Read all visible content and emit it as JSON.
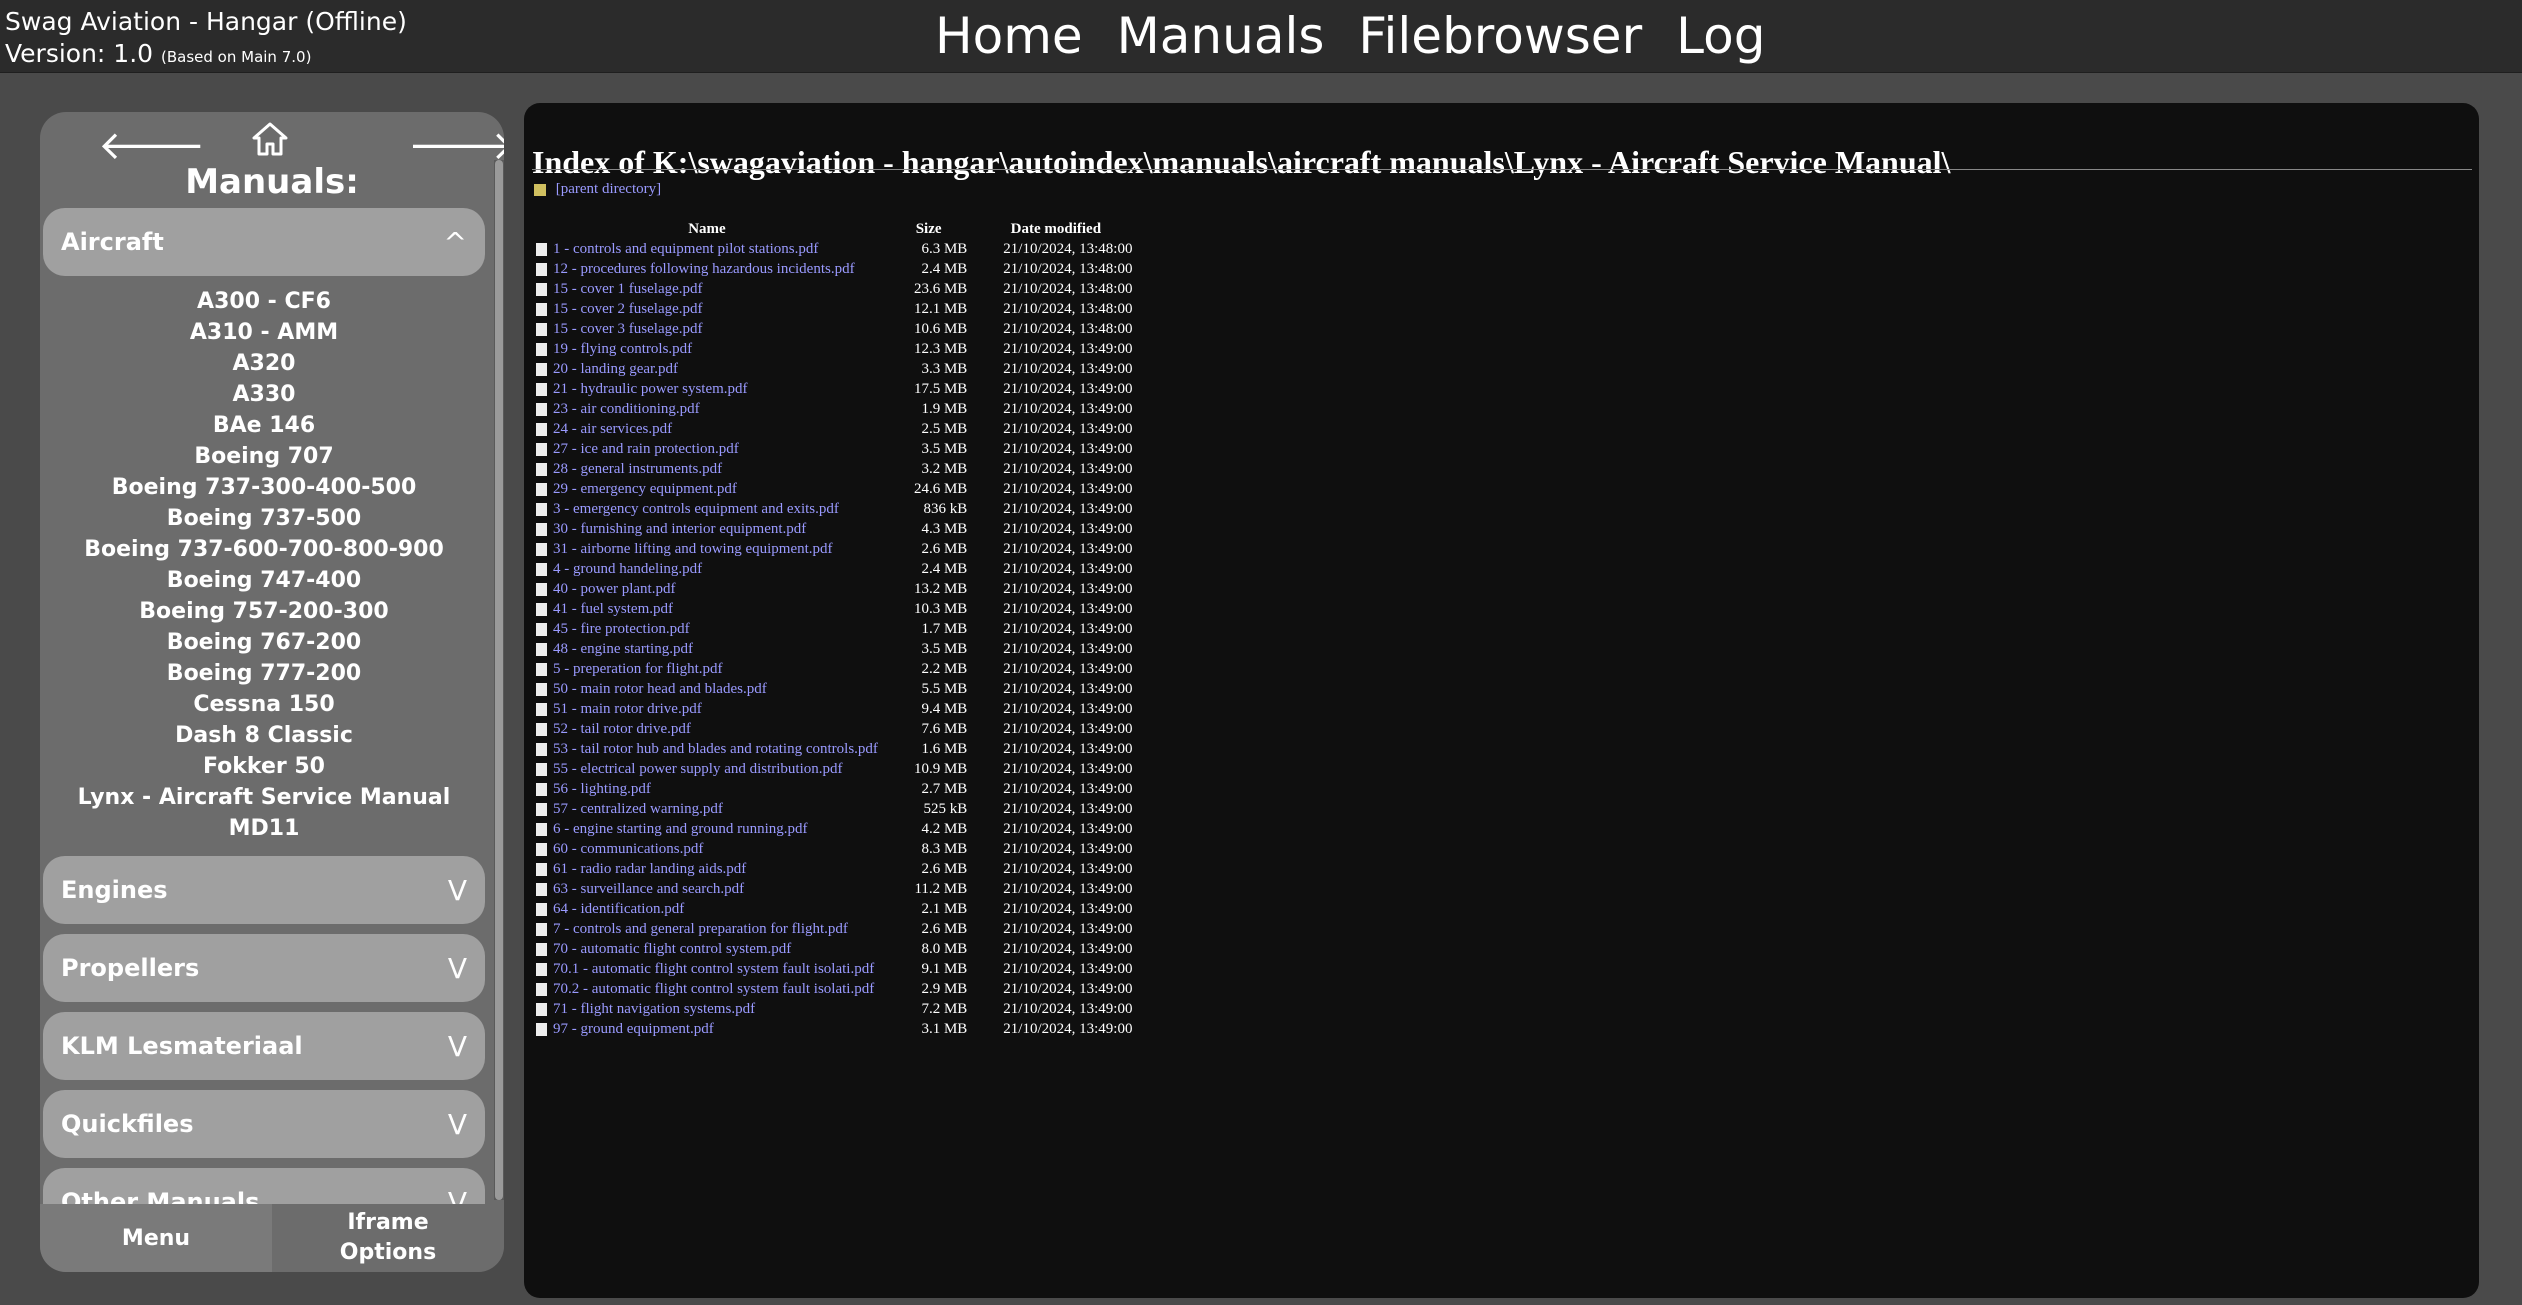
{
  "header": {
    "title": "Swag Aviation - Hangar (Offline)",
    "version": "Version: 1.0",
    "version_note": "(Based on Main 7.0)",
    "nav": [
      "Home",
      "Manuals",
      "Filebrowser",
      "Log"
    ]
  },
  "sidebar": {
    "back": "🡐",
    "forward": "🡒",
    "title": "Manuals:",
    "sections": [
      {
        "label": "Aircraft",
        "chevron": "^",
        "expanded": true,
        "items": [
          "A300 - CF6",
          "A310 - AMM",
          "A320",
          "A330",
          "BAe 146",
          "Boeing 707",
          "Boeing 737-300-400-500",
          "Boeing 737-500",
          "Boeing 737-600-700-800-900",
          "Boeing 747-400",
          "Boeing 757-200-300",
          "Boeing 767-200",
          "Boeing 777-200",
          "Cessna 150",
          "Dash 8 Classic",
          "Fokker 50",
          "Lynx - Aircraft Service Manual",
          "MD11"
        ]
      },
      {
        "label": "Engines",
        "chevron": "V"
      },
      {
        "label": "Propellers",
        "chevron": "V"
      },
      {
        "label": "KLM Lesmateriaal",
        "chevron": "V"
      },
      {
        "label": "Quickfiles",
        "chevron": "V"
      },
      {
        "label": "Other Manuals",
        "chevron": "V"
      }
    ],
    "bottom_tabs": {
      "menu": "Menu",
      "iframe_line1": "Iframe",
      "iframe_line2": "Options"
    }
  },
  "index": {
    "title": "Index of K:\\swagaviation - hangar\\autoindex\\manuals\\aircraft manuals\\Lynx - Aircraft Service Manual\\",
    "parent": "[parent directory]",
    "columns": [
      "Name",
      "Size",
      "Date modified"
    ],
    "files": [
      [
        "1 - controls and equipment pilot stations.pdf",
        "6.3 MB",
        "21/10/2024, 13:48:00"
      ],
      [
        "12 - procedures following hazardous incidents.pdf",
        "2.4 MB",
        "21/10/2024, 13:48:00"
      ],
      [
        "15 - cover 1 fuselage.pdf",
        "23.6 MB",
        "21/10/2024, 13:48:00"
      ],
      [
        "15 - cover 2 fuselage.pdf",
        "12.1 MB",
        "21/10/2024, 13:48:00"
      ],
      [
        "15 - cover 3 fuselage.pdf",
        "10.6 MB",
        "21/10/2024, 13:48:00"
      ],
      [
        "19 - flying controls.pdf",
        "12.3 MB",
        "21/10/2024, 13:49:00"
      ],
      [
        "20 - landing gear.pdf",
        "3.3 MB",
        "21/10/2024, 13:49:00"
      ],
      [
        "21 - hydraulic power system.pdf",
        "17.5 MB",
        "21/10/2024, 13:49:00"
      ],
      [
        "23 - air conditioning.pdf",
        "1.9 MB",
        "21/10/2024, 13:49:00"
      ],
      [
        "24 - air services.pdf",
        "2.5 MB",
        "21/10/2024, 13:49:00"
      ],
      [
        "27 - ice and rain protection.pdf",
        "3.5 MB",
        "21/10/2024, 13:49:00"
      ],
      [
        "28 - general instruments.pdf",
        "3.2 MB",
        "21/10/2024, 13:49:00"
      ],
      [
        "29 - emergency equipment.pdf",
        "24.6 MB",
        "21/10/2024, 13:49:00"
      ],
      [
        "3 - emergency controls equipment and exits.pdf",
        "836 kB",
        "21/10/2024, 13:49:00"
      ],
      [
        "30 - furnishing and interior equipment.pdf",
        "4.3 MB",
        "21/10/2024, 13:49:00"
      ],
      [
        "31 - airborne lifting and towing equipment.pdf",
        "2.6 MB",
        "21/10/2024, 13:49:00"
      ],
      [
        "4 - ground handeling.pdf",
        "2.4 MB",
        "21/10/2024, 13:49:00"
      ],
      [
        "40 - power plant.pdf",
        "13.2 MB",
        "21/10/2024, 13:49:00"
      ],
      [
        "41 - fuel system.pdf",
        "10.3 MB",
        "21/10/2024, 13:49:00"
      ],
      [
        "45 - fire protection.pdf",
        "1.7 MB",
        "21/10/2024, 13:49:00"
      ],
      [
        "48 - engine starting.pdf",
        "3.5 MB",
        "21/10/2024, 13:49:00"
      ],
      [
        "5 - preperation for flight.pdf",
        "2.2 MB",
        "21/10/2024, 13:49:00"
      ],
      [
        "50 - main rotor head and blades.pdf",
        "5.5 MB",
        "21/10/2024, 13:49:00"
      ],
      [
        "51 - main rotor drive.pdf",
        "9.4 MB",
        "21/10/2024, 13:49:00"
      ],
      [
        "52 - tail rotor drive.pdf",
        "7.6 MB",
        "21/10/2024, 13:49:00"
      ],
      [
        "53 - tail rotor hub and blades and rotating controls.pdf",
        "1.6 MB",
        "21/10/2024, 13:49:00"
      ],
      [
        "55 - electrical power supply and distribution.pdf",
        "10.9 MB",
        "21/10/2024, 13:49:00"
      ],
      [
        "56 - lighting.pdf",
        "2.7 MB",
        "21/10/2024, 13:49:00"
      ],
      [
        "57 - centralized warning.pdf",
        "525 kB",
        "21/10/2024, 13:49:00"
      ],
      [
        "6 - engine starting and ground running.pdf",
        "4.2 MB",
        "21/10/2024, 13:49:00"
      ],
      [
        "60 - communications.pdf",
        "8.3 MB",
        "21/10/2024, 13:49:00"
      ],
      [
        "61 - radio radar landing aids.pdf",
        "2.6 MB",
        "21/10/2024, 13:49:00"
      ],
      [
        "63 - surveillance and search.pdf",
        "11.2 MB",
        "21/10/2024, 13:49:00"
      ],
      [
        "64 - identification.pdf",
        "2.1 MB",
        "21/10/2024, 13:49:00"
      ],
      [
        "7 - controls and general preparation for flight.pdf",
        "2.6 MB",
        "21/10/2024, 13:49:00"
      ],
      [
        "70 - automatic flight control system.pdf",
        "8.0 MB",
        "21/10/2024, 13:49:00"
      ],
      [
        "70.1 - automatic flight control system fault isolati.pdf",
        "9.1 MB",
        "21/10/2024, 13:49:00"
      ],
      [
        "70.2 - automatic flight control system fault isolati.pdf",
        "2.9 MB",
        "21/10/2024, 13:49:00"
      ],
      [
        "71 - flight navigation systems.pdf",
        "7.2 MB",
        "21/10/2024, 13:49:00"
      ],
      [
        "97 - ground equipment.pdf",
        "3.1 MB",
        "21/10/2024, 13:49:00"
      ]
    ]
  }
}
